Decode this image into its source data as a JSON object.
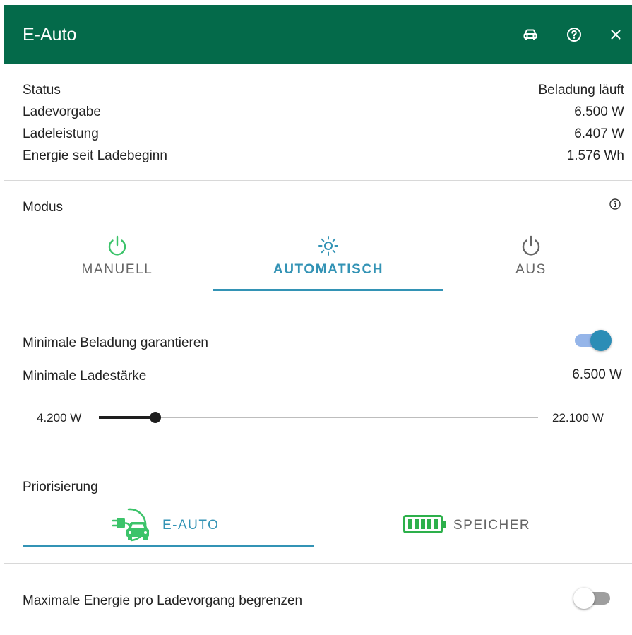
{
  "header": {
    "title": "E-Auto",
    "icons": [
      "car-icon",
      "help-icon",
      "close-icon"
    ]
  },
  "status": {
    "rows": [
      {
        "label": "Status",
        "value": "Beladung läuft"
      },
      {
        "label": "Ladevorgabe",
        "value": "6.500 W"
      },
      {
        "label": "Ladeleistung",
        "value": "6.407 W"
      },
      {
        "label": "Energie seit Ladebeginn",
        "value": "1.576 Wh"
      }
    ]
  },
  "modus": {
    "label": "Modus",
    "info_icon": "info-icon",
    "tabs": [
      {
        "label": "MANUELL",
        "icon": "power-icon",
        "active": false
      },
      {
        "label": "AUTOMATISCH",
        "icon": "sun-icon",
        "active": true
      },
      {
        "label": "AUS",
        "icon": "power-icon",
        "active": false
      }
    ]
  },
  "min_charge": {
    "label": "Minimale Beladung garantieren",
    "enabled": true
  },
  "min_current": {
    "label": "Minimale Ladestärke",
    "value": "6.500 W",
    "slider": {
      "min_label": "4.200 W",
      "max_label": "22.100 W",
      "min": 4200,
      "max": 22100,
      "current": 6500
    }
  },
  "priority": {
    "label": "Priorisierung",
    "options": [
      {
        "label": "E-AUTO",
        "icon": "ev-charging-car-icon",
        "active": true
      },
      {
        "label": "SPEICHER",
        "icon": "battery-icon",
        "active": false
      }
    ]
  },
  "max_energy": {
    "label": "Maximale Energie pro Ladevorgang begrenzen",
    "enabled": false
  },
  "colors": {
    "header_bg": "#046a4a",
    "accent_blue": "#3393b5",
    "accent_green": "#3cc36a",
    "battery_green": "#2db04b",
    "icon_gray": "#666666"
  }
}
